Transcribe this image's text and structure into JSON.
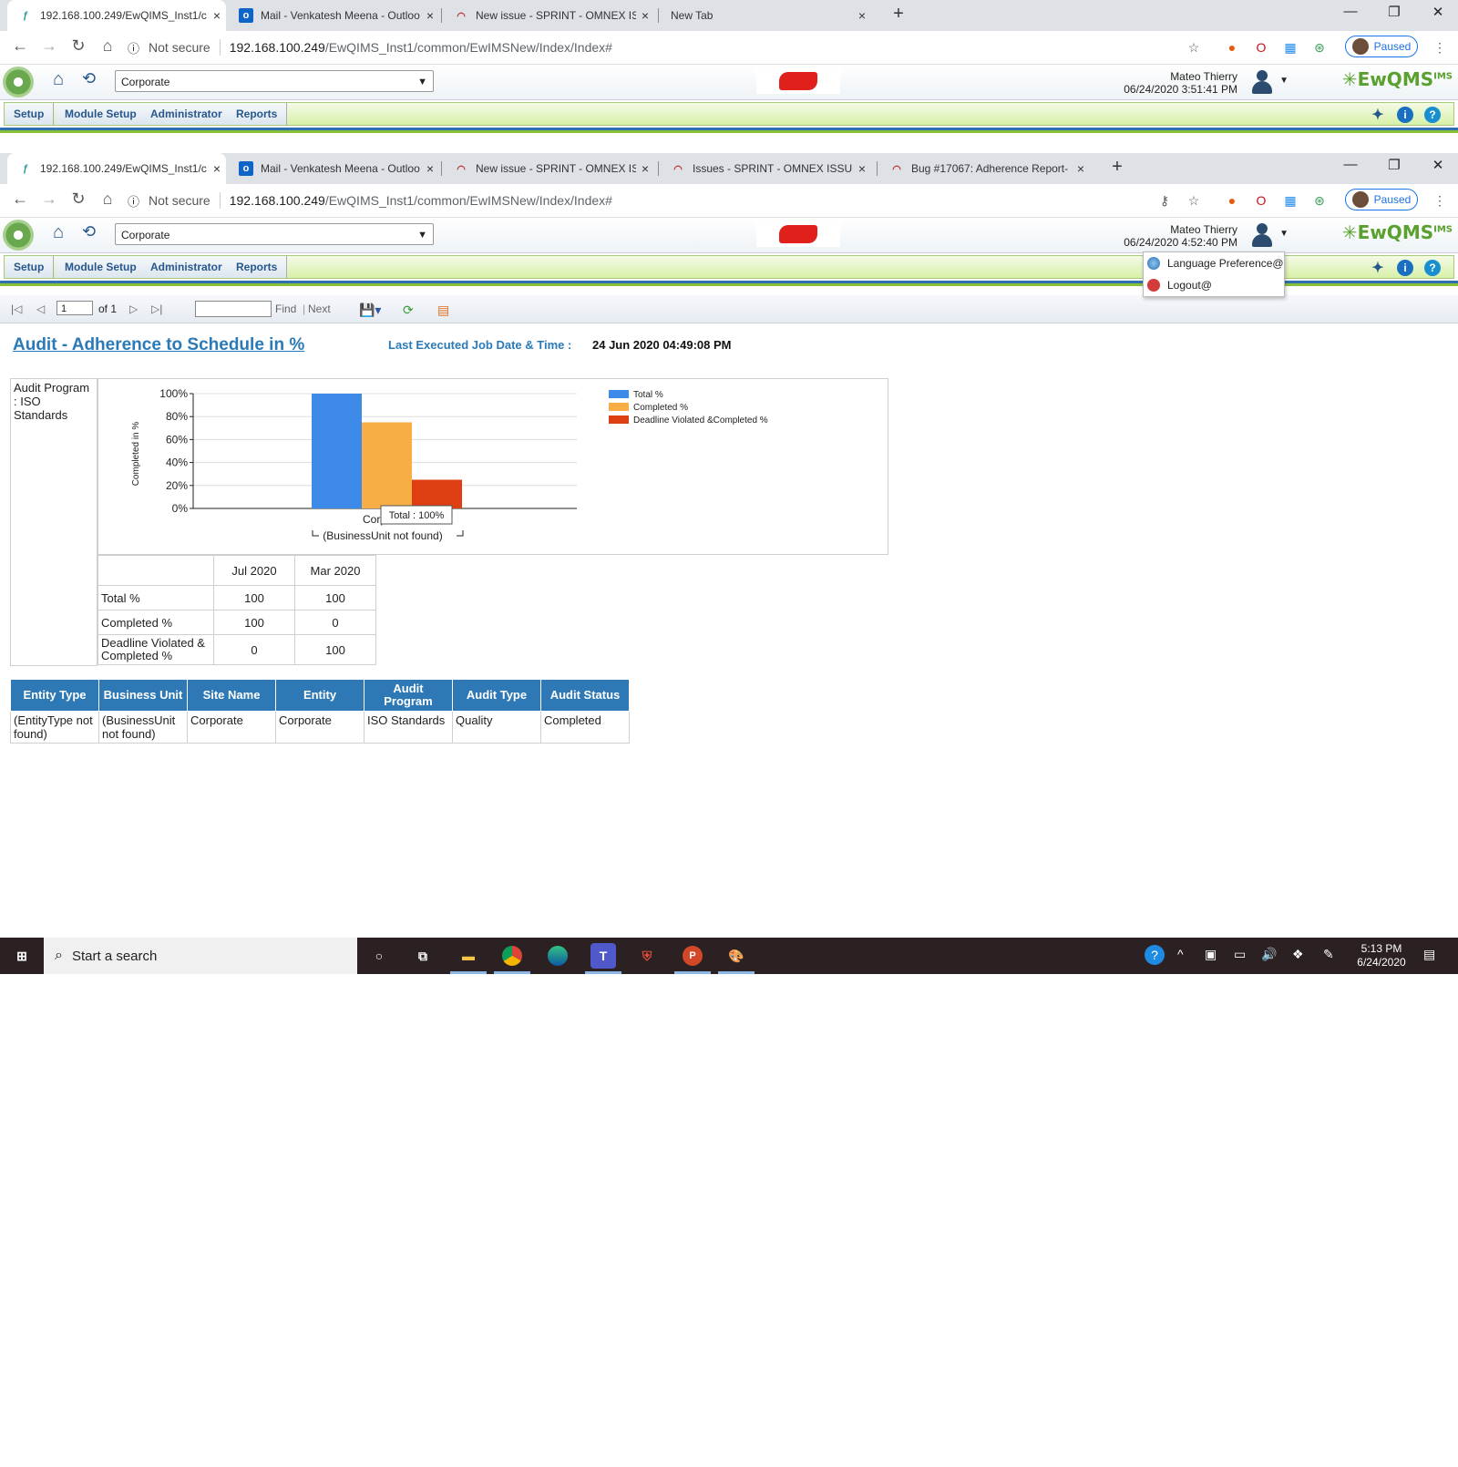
{
  "browser1": {
    "tabs": [
      {
        "label": "192.168.100.249/EwQIMS_Inst1/c",
        "icon": "ewqims-favicon",
        "active": true
      },
      {
        "label": "Mail - Venkatesh Meena - Outloo",
        "icon": "outlook-icon"
      },
      {
        "label": "New issue - SPRINT - OMNEX ISS",
        "icon": "redmine-icon"
      },
      {
        "label": "New Tab",
        "icon": ""
      }
    ],
    "security": "Not secure",
    "url_host": "192.168.100.249",
    "url_path": "/EwQIMS_Inst1/common/EwIMSNew/Index/Index#",
    "profile": "Paused"
  },
  "app1": {
    "org_select": "Corporate",
    "user_name": "Mateo Thierry",
    "datetime": "06/24/2020 3:51:41 PM",
    "menu": [
      "Setup",
      "Module Setup",
      "Administrator",
      "Reports"
    ]
  },
  "browser2": {
    "tabs": [
      {
        "label": "192.168.100.249/EwQIMS_Inst1/c",
        "icon": "ewqims-favicon",
        "active": true
      },
      {
        "label": "Mail - Venkatesh Meena - Outloo",
        "icon": "outlook-icon"
      },
      {
        "label": "New issue - SPRINT - OMNEX ISS",
        "icon": "redmine-icon"
      },
      {
        "label": "Issues - SPRINT - OMNEX ISSUE",
        "icon": "redmine-icon"
      },
      {
        "label": "Bug #17067: Adherence Report-",
        "icon": "redmine-icon"
      }
    ],
    "security": "Not secure",
    "url_host": "192.168.100.249",
    "url_path": "/EwQIMS_Inst1/common/EwIMSNew/Index/Index#",
    "profile": "Paused"
  },
  "app2": {
    "org_select": "Corporate",
    "user_name": "Mateo Thierry",
    "datetime": "06/24/2020 4:52:40 PM",
    "menu": [
      "Setup",
      "Module Setup",
      "Administrator",
      "Reports"
    ],
    "user_menu": [
      "Language Preference@",
      "Logout@"
    ]
  },
  "brand": {
    "name": "EwQMS",
    "sup": "IMS"
  },
  "report_toolbar": {
    "page_value": "1",
    "of": "of 1",
    "find": "Find",
    "next": "Next"
  },
  "report": {
    "title": "Audit - Adherence to Schedule in %",
    "last_job_label": "Last Executed Job Date & Time :",
    "last_job_value": "24 Jun 2020 04:49:08 PM",
    "program_label": "Audit Program : ISO Standards"
  },
  "chart_data": {
    "type": "bar",
    "categories": [
      "Corp"
    ],
    "series": [
      {
        "name": "Total %",
        "values": [
          100
        ],
        "color": "#3d8ae8"
      },
      {
        "name": "Completed %",
        "values": [
          75
        ],
        "color": "#f9ae45"
      },
      {
        "name": "Deadline Violated &Completed %",
        "values": [
          25
        ],
        "color": "#dd3f13"
      }
    ],
    "ylabel": "Completed in %",
    "yticks": [
      "0%",
      "20%",
      "40%",
      "60%",
      "80%",
      "100%"
    ],
    "ylim": [
      0,
      100
    ],
    "xlabel": "(BusinessUnit not found)",
    "tooltip": "Total : 100%",
    "legend_position": "top-right"
  },
  "data_table": {
    "columns": [
      "Jul 2020",
      "Mar 2020"
    ],
    "rows": [
      {
        "label": "Total %",
        "values": [
          "100",
          "100"
        ]
      },
      {
        "label": "Completed %",
        "values": [
          "100",
          "0"
        ]
      },
      {
        "label": "Deadline Violated & Completed %",
        "values": [
          "0",
          "100"
        ]
      }
    ]
  },
  "entity_table": {
    "headers": [
      "Entity Type",
      "Business Unit",
      "Site Name",
      "Entity",
      "Audit Program",
      "Audit Type",
      "Audit Status"
    ],
    "rows": [
      [
        "(EntityType not found)",
        "(BusinessUnit not found)",
        "Corporate",
        "Corporate",
        "ISO Standards",
        "Quality",
        "Completed"
      ]
    ]
  },
  "taskbar": {
    "search_placeholder": "Start a search",
    "time": "5:13 PM",
    "date": "6/24/2020",
    "apps": [
      "cortana-icon",
      "task-view-icon",
      "file-explorer-icon",
      "chrome-icon",
      "edge-icon",
      "teams-icon",
      "shield-app-icon",
      "powerpoint-icon",
      "paint-icon"
    ]
  }
}
